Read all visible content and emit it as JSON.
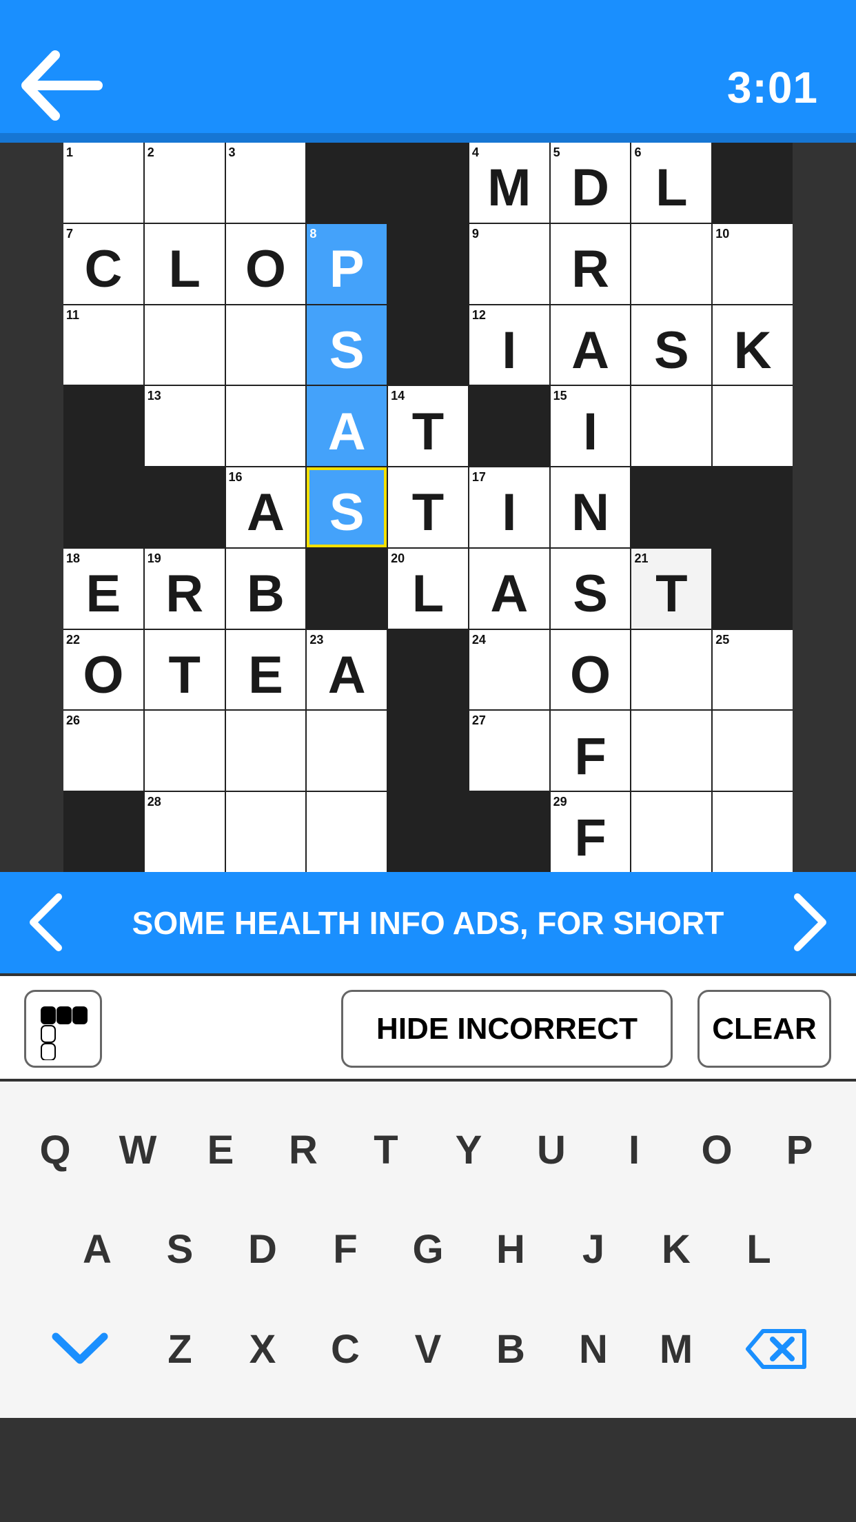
{
  "header": {
    "timer": "3:01",
    "back_icon": "arrow-left-icon"
  },
  "colors": {
    "accent": "#1a8ffe",
    "highlight": "#44a2fa",
    "selected_border": "#f3e000",
    "block": "#222222"
  },
  "grid": {
    "rows": [
      [
        {
          "n": "1",
          "l": ""
        },
        {
          "n": "2",
          "l": ""
        },
        {
          "n": "3",
          "l": ""
        },
        null,
        null,
        {
          "n": "4",
          "l": "M"
        },
        {
          "n": "5",
          "l": "D"
        },
        {
          "n": "6",
          "l": "L"
        },
        null
      ],
      [
        {
          "n": "7",
          "l": "C"
        },
        {
          "l": "L"
        },
        {
          "l": "O"
        },
        {
          "n": "8",
          "l": "P",
          "s": "hl"
        },
        null,
        {
          "n": "9",
          "l": ""
        },
        {
          "l": "R"
        },
        {
          "l": ""
        },
        {
          "n": "10",
          "l": ""
        }
      ],
      [
        {
          "n": "11",
          "l": ""
        },
        {
          "l": ""
        },
        {
          "l": ""
        },
        {
          "l": "S",
          "s": "hl"
        },
        null,
        {
          "n": "12",
          "l": "I"
        },
        {
          "l": "A"
        },
        {
          "l": "S"
        },
        {
          "l": "K"
        }
      ],
      [
        null,
        {
          "n": "13",
          "l": ""
        },
        {
          "l": ""
        },
        {
          "l": "A",
          "s": "hl"
        },
        {
          "n": "14",
          "l": "T"
        },
        null,
        {
          "n": "15",
          "l": "I"
        },
        {
          "l": ""
        },
        {
          "l": ""
        }
      ],
      [
        null,
        null,
        {
          "n": "16",
          "l": "A"
        },
        {
          "l": "S",
          "s": "sel"
        },
        {
          "l": "T"
        },
        {
          "n": "17",
          "l": "I"
        },
        {
          "l": "N"
        },
        null,
        null
      ],
      [
        {
          "n": "18",
          "l": "E"
        },
        {
          "n": "19",
          "l": "R"
        },
        {
          "l": "B"
        },
        null,
        {
          "n": "20",
          "l": "L"
        },
        {
          "l": "A"
        },
        {
          "l": "S"
        },
        {
          "n": "21",
          "l": "T",
          "s": "dim"
        },
        null
      ],
      [
        {
          "n": "22",
          "l": "O"
        },
        {
          "l": "T"
        },
        {
          "l": "E"
        },
        {
          "n": "23",
          "l": "A"
        },
        null,
        {
          "n": "24",
          "l": ""
        },
        {
          "l": "O"
        },
        {
          "l": ""
        },
        {
          "n": "25",
          "l": ""
        }
      ],
      [
        {
          "n": "26",
          "l": ""
        },
        {
          "l": ""
        },
        {
          "l": ""
        },
        {
          "l": ""
        },
        null,
        {
          "n": "27",
          "l": ""
        },
        {
          "l": "F"
        },
        {
          "l": ""
        },
        {
          "l": ""
        }
      ],
      [
        null,
        {
          "n": "28",
          "l": ""
        },
        {
          "l": ""
        },
        {
          "l": ""
        },
        null,
        null,
        {
          "n": "29",
          "l": "F"
        },
        {
          "l": ""
        },
        {
          "l": ""
        }
      ]
    ]
  },
  "clue": {
    "text": "SOME HEALTH INFO ADS, FOR SHORT",
    "prev_icon": "chevron-left-icon",
    "next_icon": "chevron-right-icon"
  },
  "toolbar": {
    "grid_toggle_icon": "grid-layout-icon",
    "hide_incorrect": "HIDE INCORRECT",
    "clear": "CLEAR"
  },
  "keyboard": {
    "row1": [
      "Q",
      "W",
      "E",
      "R",
      "T",
      "Y",
      "U",
      "I",
      "O",
      "P"
    ],
    "row2": [
      "A",
      "S",
      "D",
      "F",
      "G",
      "H",
      "J",
      "K",
      "L"
    ],
    "row3": [
      "Z",
      "X",
      "C",
      "V",
      "B",
      "N",
      "M"
    ],
    "hide_icon": "chevron-down-icon",
    "backspace_icon": "backspace-icon"
  }
}
